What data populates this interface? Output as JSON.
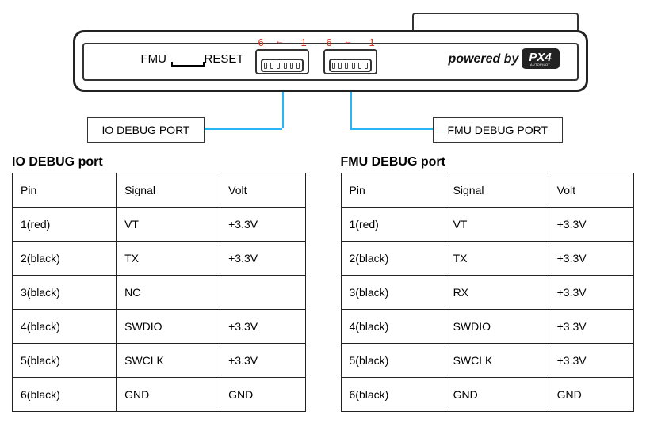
{
  "board": {
    "fmu_label": "FMU",
    "reset_label": "RESET",
    "powered_label": "powered by",
    "px4_label": "PX4",
    "px4_sub": "AUTOPILOT",
    "pin6": "6",
    "pin1": "1",
    "arrow": "←"
  },
  "callout_left": "IO DEBUG PORT",
  "callout_right": "FMU DEBUG PORT",
  "tables": {
    "io": {
      "title": "IO DEBUG port",
      "headers": {
        "pin": "Pin",
        "signal": "Signal",
        "volt": "Volt"
      },
      "rows": [
        {
          "pin": "1(red)",
          "signal": "VT",
          "volt": "+3.3V"
        },
        {
          "pin": "2(black)",
          "signal": "TX",
          "volt": "+3.3V"
        },
        {
          "pin": "3(black)",
          "signal": "NC",
          "volt": ""
        },
        {
          "pin": "4(black)",
          "signal": "SWDIO",
          "volt": "+3.3V"
        },
        {
          "pin": "5(black)",
          "signal": "SWCLK",
          "volt": "+3.3V"
        },
        {
          "pin": "6(black)",
          "signal": "GND",
          "volt": "GND"
        }
      ]
    },
    "fmu": {
      "title": "FMU DEBUG port",
      "headers": {
        "pin": "Pin",
        "signal": "Signal",
        "volt": "Volt"
      },
      "rows": [
        {
          "pin": "1(red)",
          "signal": "VT",
          "volt": "+3.3V"
        },
        {
          "pin": "2(black)",
          "signal": "TX",
          "volt": "+3.3V"
        },
        {
          "pin": "3(black)",
          "signal": "RX",
          "volt": "+3.3V"
        },
        {
          "pin": "4(black)",
          "signal": "SWDIO",
          "volt": "+3.3V"
        },
        {
          "pin": "5(black)",
          "signal": "SWCLK",
          "volt": "+3.3V"
        },
        {
          "pin": "6(black)",
          "signal": "GND",
          "volt": "GND"
        }
      ]
    }
  }
}
